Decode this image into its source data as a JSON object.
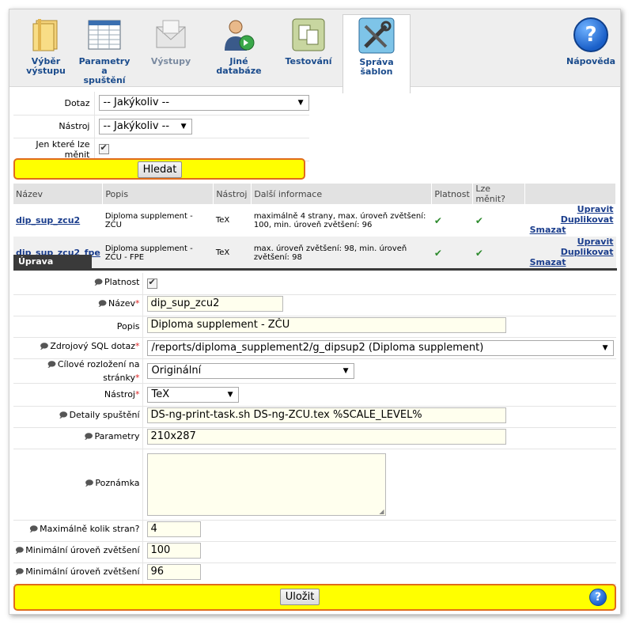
{
  "nav": {
    "items": [
      {
        "label_line1": "Výběr",
        "label_line2": "výstupu"
      },
      {
        "label_line1": "Parametry a",
        "label_line2": "spuštění"
      },
      {
        "label_line1": "Výstupy",
        "label_line2": ""
      },
      {
        "label_line1": "Jiné",
        "label_line2": "databáze"
      },
      {
        "label_line1": "Testování",
        "label_line2": ""
      },
      {
        "label_line1": "Správa",
        "label_line2": "šablon"
      }
    ],
    "help_label": "Nápověda"
  },
  "search": {
    "dotaz_label": "Dotaz",
    "dotaz_value": "-- Jakýkoliv --",
    "nastroj_label": "Nástroj",
    "nastroj_value": "-- Jakýkoliv --",
    "editable_label": "Jen které lze měnit",
    "search_button": "Hledat"
  },
  "results": {
    "headers": [
      "Název",
      "Popis",
      "Nástroj",
      "Další informace",
      "Platnost",
      "Lze měnit?",
      ""
    ],
    "rows": [
      {
        "name": "dip_sup_zcu2",
        "popis": "Diploma supplement - ZČU",
        "nastroj": "TeX",
        "info": "maximálně 4 strany, max. úroveň zvětšení: 100, min. úroveň zvětšení: 96",
        "edit": "Upravit",
        "duplicate": "Duplikovat",
        "delete": "Smazat"
      },
      {
        "name": "dip_sup_zcu2_fpe",
        "popis": "Diploma supplement - ZČU - FPE",
        "nastroj": "TeX",
        "info": "max. úroveň zvětšení: 98, min. úroveň zvětšení: 98",
        "edit": "Upravit",
        "duplicate": "Duplikovat",
        "delete": "Smazat"
      }
    ]
  },
  "edit": {
    "section_title": "Úprava šablony",
    "fields": {
      "platnost_label": "Platnost",
      "nazev_label": "Název",
      "nazev_value": "dip_sup_zcu2",
      "popis_label": "Popis",
      "popis_value": "Diploma supplement - ZČU",
      "sql_label": "Zdrojový SQL dotaz",
      "sql_value": "/reports/diploma_supplement2/g_dipsup2 (Diploma supplement)",
      "layout_label": "Cílové rozložení na stránky",
      "layout_value": "Originální",
      "nastroj_label": "Nástroj",
      "nastroj_value": "TeX",
      "detaily_label": "Detaily spuštění",
      "detaily_value": "DS-ng-print-task.sh DS-ng-ZCU.tex %SCALE_LEVEL%",
      "parametry_label": "Parametry",
      "parametry_value": "210x287",
      "poznamka_label": "Poznámka",
      "poznamka_value": "",
      "max_pages_label": "Maximálně kolik stran?",
      "max_pages_value": "4",
      "min_zoom_label_1": "Minimální úroveň zvětšení",
      "min_zoom_value_1": "100",
      "min_zoom_label_2": "Minimální úroveň zvětšení",
      "min_zoom_value_2": "96"
    },
    "save_button": "Uložit"
  },
  "colors": {
    "highlight": "#ffff00",
    "highlight_border": "#e06c1c",
    "link": "#1a3d8c",
    "nav_text": "#1a4b8c"
  }
}
